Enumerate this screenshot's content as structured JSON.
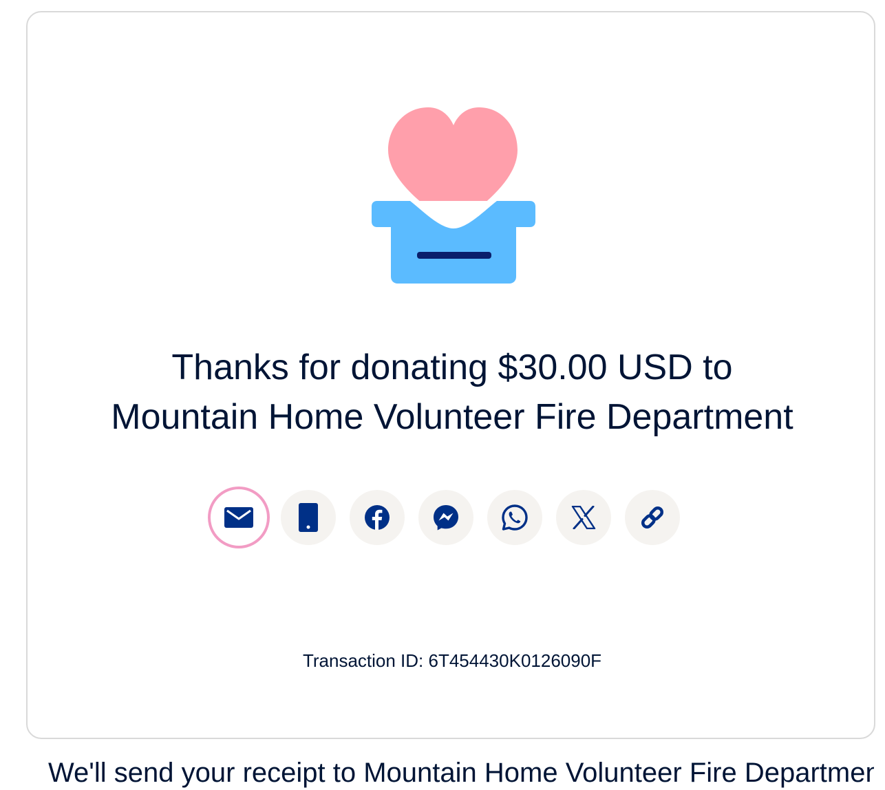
{
  "confirmation": {
    "heading_line1": "Thanks for donating $30.00 USD to",
    "heading_line2": "Mountain Home Volunteer Fire Department",
    "transaction_label": "Transaction ID: 6T454430K0126090F"
  },
  "share": {
    "buttons": [
      {
        "icon": "email-icon",
        "selected": true
      },
      {
        "icon": "phone-icon"
      },
      {
        "icon": "facebook-icon"
      },
      {
        "icon": "messenger-icon"
      },
      {
        "icon": "whatsapp-icon"
      },
      {
        "icon": "x-icon"
      },
      {
        "icon": "link-icon"
      }
    ]
  },
  "footer": {
    "text": "We'll send your receipt to Mountain Home Volunteer Fire Department to"
  },
  "colors": {
    "text": "#001435",
    "icon": "#003087",
    "heart": "#ff9fab",
    "box": "#5bbbff",
    "button_bg": "#f5f3f0",
    "selected_ring": "#f29cc4"
  }
}
